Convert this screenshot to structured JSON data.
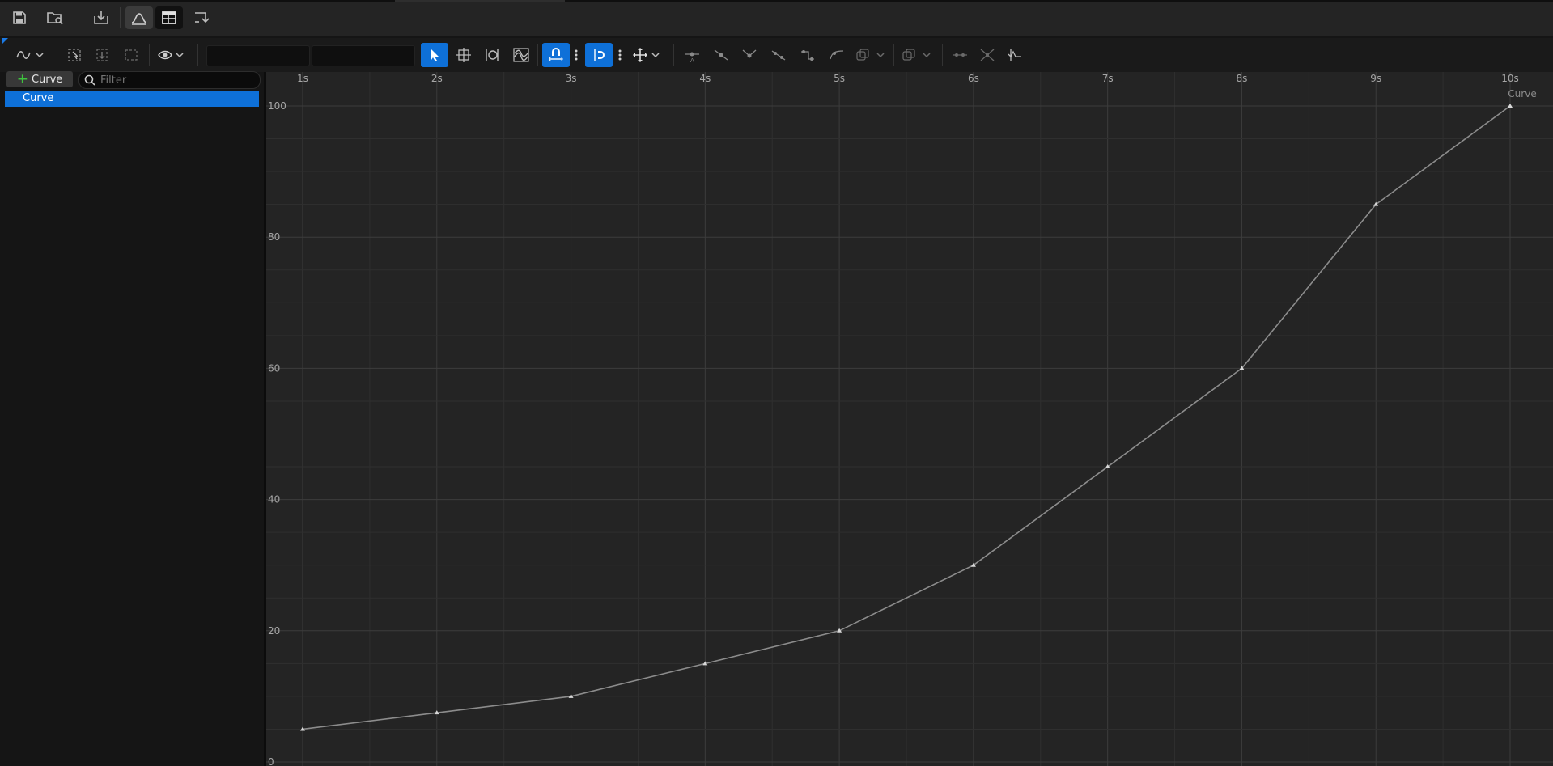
{
  "icons": {
    "save": "save-icon",
    "browse": "browse-asset-icon",
    "reimport": "reimport-icon",
    "curve_view": "curve-view-icon",
    "table_view": "table-view-icon",
    "export": "export-icon"
  },
  "toolbar": {
    "time_value": "",
    "value_value": ""
  },
  "sidebar": {
    "add_button_label": "Curve",
    "filter_placeholder": "Filter",
    "items": [
      {
        "label": "Curve",
        "selected": true
      }
    ]
  },
  "colors": {
    "accent": "#0e70d8",
    "curve": "#8c8c8c",
    "add_icon": "#3ec23e"
  },
  "chart_data": {
    "type": "line",
    "curve_label": "Curve",
    "x_ticks": [
      "1s",
      "2s",
      "3s",
      "4s",
      "5s",
      "6s",
      "7s",
      "8s",
      "9s",
      "10s"
    ],
    "y_ticks": [
      "0",
      "20",
      "40",
      "60",
      "80",
      "100"
    ],
    "xlim": [
      1,
      10
    ],
    "ylim": [
      0,
      100
    ],
    "grid": true,
    "series": [
      {
        "name": "Curve",
        "x": [
          1,
          2,
          3,
          4,
          5,
          6,
          7,
          8,
          9,
          10
        ],
        "y": [
          5,
          7.5,
          10,
          15,
          20,
          30,
          45,
          60,
          85,
          100
        ]
      }
    ]
  }
}
